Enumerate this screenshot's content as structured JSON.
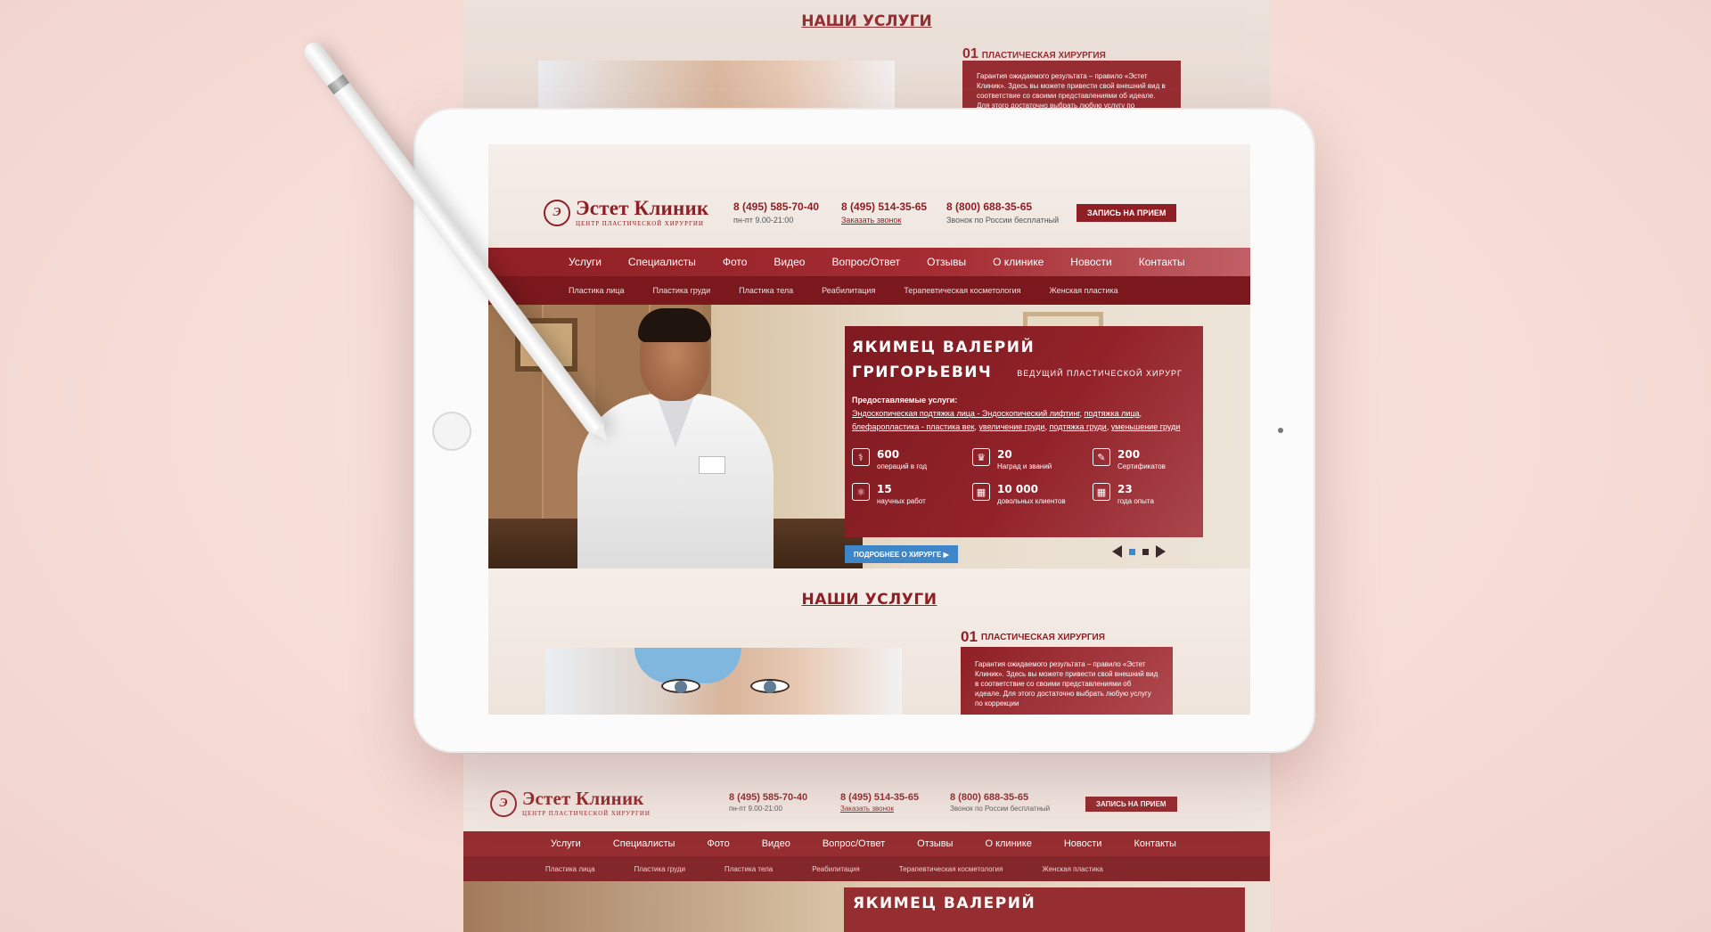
{
  "site": {
    "logo_name": "Эстет Клиник",
    "logo_sub": "ЦЕНТР ПЛАСТИЧЕСКОЙ ХИРУРГИИ",
    "phones": [
      {
        "number": "8 (495) 585-70-40",
        "note": "пн-пт 9.00-21:00",
        "link": false
      },
      {
        "number": "8 (495) 514-35-65",
        "note": "Заказать звонок",
        "link": true
      },
      {
        "number": "8 (800) 688-35-65",
        "note": "Звонок по России бесплатный",
        "link": false
      }
    ],
    "cta": "ЗАПИСЬ НА ПРИЕМ",
    "nav": [
      "Услуги",
      "Специалисты",
      "Фото",
      "Видео",
      "Вопрос/Ответ",
      "Отзывы",
      "О клинике",
      "Новости",
      "Контакты"
    ],
    "subnav": [
      "Пластика лица",
      "Пластика груди",
      "Пластика тела",
      "Реабилитация",
      "Терапевтическая косметология",
      "Женская пластика"
    ]
  },
  "hero": {
    "name_line1": "ЯКИМЕЦ ВАЛЕРИЙ",
    "name_line2": "ГРИГОРЬЕВИЧ",
    "role": "ВЕДУЩИЙ ПЛАСТИЧЕСКОЙ ХИРУРГ",
    "services_label": "Предоставляемые услуги:",
    "services": [
      "Эндоскопическая подтяжка лица - Эндоскопический лифтинг",
      "подтяжка лица",
      "блефаропластика - пластика век",
      "увеличение груди",
      "подтяжка груди",
      "уменьшение груди"
    ],
    "stats": [
      {
        "icon": "surgery-tools-icon",
        "glyph": "⚕",
        "value": "600",
        "caption": "операций в год"
      },
      {
        "icon": "award-icon",
        "glyph": "♛",
        "value": "20",
        "caption": "Наград и званий"
      },
      {
        "icon": "certificate-icon",
        "glyph": "✎",
        "value": "200",
        "caption": "Сертификатов"
      },
      {
        "icon": "atom-icon",
        "glyph": "⚛",
        "value": "15",
        "caption": "научных работ"
      },
      {
        "icon": "calendar-icon",
        "glyph": "▦",
        "value": "10 000",
        "caption": "довольных клиентов"
      },
      {
        "icon": "calendar-icon",
        "glyph": "▦",
        "value": "23",
        "caption": "года опыта"
      }
    ],
    "more_button": "ПОДРОБНЕЕ О ХИРУРГЕ ▶"
  },
  "services_section": {
    "title": "НАШИ УСЛУГИ",
    "num": "01",
    "item_title": "ПЛАСТИЧЕСКАЯ ХИРУРГИЯ",
    "text": "Гарантия ожидаемого результата – правило «Эстет Клиник». Здесь вы можете привести свой внешний вид в соответствие со своими представлениями об идеале. Для этого достаточно выбрать любую услугу по коррекции"
  },
  "colors": {
    "brand": "#8e1f24",
    "accent": "#3f86c9"
  }
}
